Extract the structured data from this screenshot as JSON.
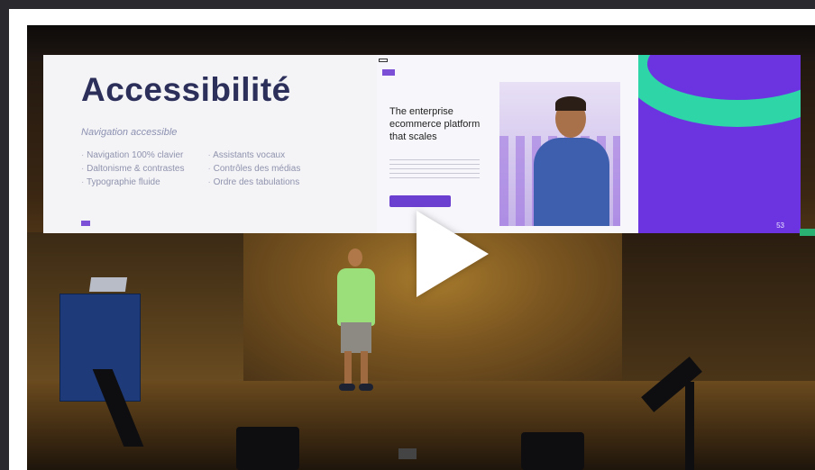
{
  "video": {
    "play_icon": "play-icon"
  },
  "slide": {
    "title": "Accessibilité",
    "subtitle": "Navigation accessible",
    "col_left": [
      "Navigation 100% clavier",
      "Daltonisme & contrastes",
      "Typographie fluide"
    ],
    "col_right": [
      "Assistants vocaux",
      "Contrôles des médias",
      "Ordre des tabulations"
    ],
    "page_number": "53"
  },
  "website": {
    "headline": "The enterprise ecommerce platform that scales"
  },
  "colors": {
    "slide_bg": "#f4f4f7",
    "title": "#2b2f5a",
    "purple": "#6c34e0",
    "teal": "#2ed6a7",
    "play": "#ffffff"
  }
}
